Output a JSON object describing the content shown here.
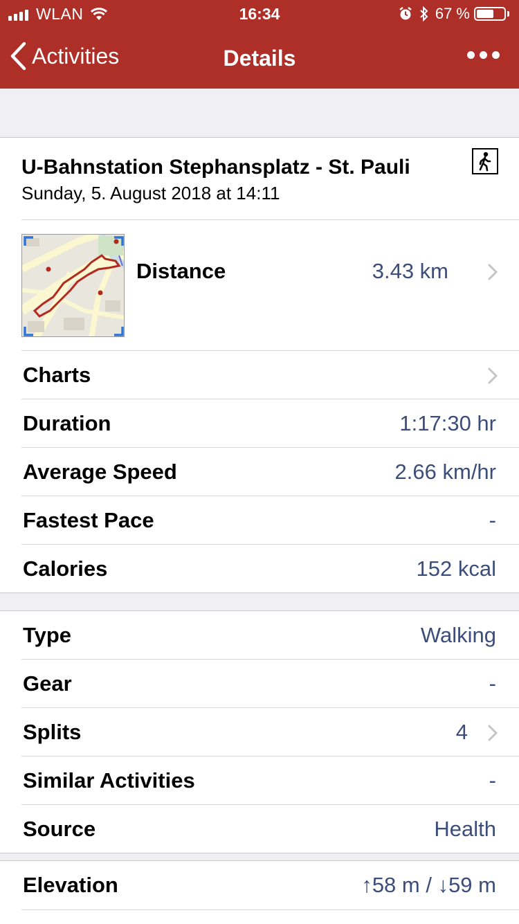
{
  "status_bar": {
    "carrier": "WLAN",
    "time": "16:34",
    "battery": "67 %",
    "battery_level": 0.67
  },
  "nav": {
    "back_label": "Activities",
    "title": "Details"
  },
  "activity": {
    "title": "U-Bahnstation Stephansplatz - St. Pauli",
    "datetime": "Sunday, 5. August 2018 at 14:11",
    "type_icon": "walking-person-icon"
  },
  "stats": {
    "distance_label": "Distance",
    "distance_value": "3.43 km",
    "charts_label": "Charts",
    "duration_label": "Duration",
    "duration_value": "1:17:30 hr",
    "avg_speed_label": "Average Speed",
    "avg_speed_value": "2.66 km/hr",
    "fastest_pace_label": "Fastest Pace",
    "fastest_pace_value": "-",
    "calories_label": "Calories",
    "calories_value": "152 kcal"
  },
  "info": {
    "type_label": "Type",
    "type_value": "Walking",
    "gear_label": "Gear",
    "gear_value": "-",
    "splits_label": "Splits",
    "splits_value": "4",
    "similar_label": "Similar Activities",
    "similar_value": "-",
    "source_label": "Source",
    "source_value": "Health"
  },
  "elevation": {
    "label": "Elevation",
    "value": "↑58 m / ↓59 m"
  },
  "colors": {
    "nav_bar": "#ad2f28",
    "value_text": "#3b4d7a",
    "route": "#b22a1f"
  }
}
